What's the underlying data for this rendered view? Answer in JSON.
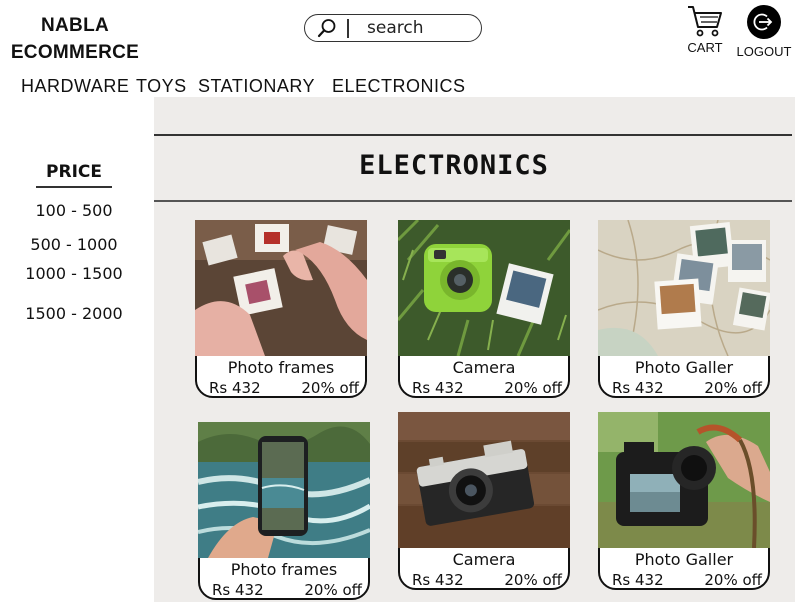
{
  "header": {
    "brand_line1": "NABLA",
    "brand_line2": "ECOMMERCE",
    "search_placeholder": "search",
    "cart_label": "CART",
    "logout_label": "LOGOUT"
  },
  "nav": [
    "HARDWARE",
    "TOYS",
    "STATIONARY",
    "ELECTRONICS"
  ],
  "sidebar": {
    "title": "PRICE",
    "ranges": [
      "100 - 500",
      "500 - 1000",
      "1000 - 1500",
      "1500 - 2000"
    ]
  },
  "main": {
    "heading": "ELECTRONICS",
    "products": [
      {
        "name": "Photo frames",
        "price": "Rs 432",
        "discount": "20% off",
        "image": "hands-holding-photo-slides"
      },
      {
        "name": "Camera",
        "price": "Rs 432",
        "discount": "20% off",
        "image": "green-instant-camera-on-grass"
      },
      {
        "name": "Photo Galler",
        "price": "Rs 432",
        "discount": "20% off",
        "image": "polaroids-on-map"
      },
      {
        "name": "Photo frames",
        "price": "Rs 432",
        "discount": "20% off",
        "image": "phone-photo-of-river"
      },
      {
        "name": "Camera",
        "price": "Rs 432",
        "discount": "20% off",
        "image": "retro-camera-on-wood"
      },
      {
        "name": "Photo Galler",
        "price": "Rs 432",
        "discount": "20% off",
        "image": "hand-holding-dslr"
      }
    ]
  },
  "colors": {
    "panel_bg": "#eeecea",
    "text": "#111111",
    "logout_circle": "#000000"
  }
}
